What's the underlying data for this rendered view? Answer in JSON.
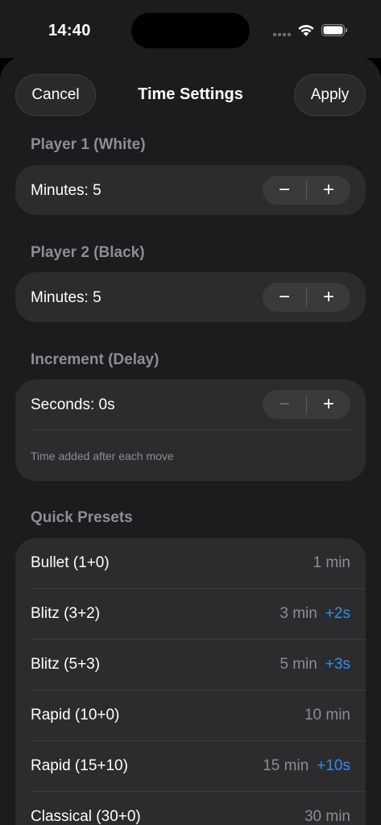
{
  "status": {
    "time": "14:40"
  },
  "nav": {
    "cancel": "Cancel",
    "title": "Time Settings",
    "apply": "Apply"
  },
  "player1": {
    "header": "Player 1 (White)",
    "label": "Minutes: 5",
    "minus": "−",
    "plus": "+"
  },
  "player2": {
    "header": "Player 2 (Black)",
    "label": "Minutes: 5",
    "minus": "−",
    "plus": "+"
  },
  "increment": {
    "header": "Increment (Delay)",
    "label": "Seconds: 0s",
    "minus": "−",
    "plus": "+",
    "minus_disabled": true,
    "note": "Time added after each move"
  },
  "presets": {
    "header": "Quick Presets",
    "items": [
      {
        "name": "Bullet (1+0)",
        "minutes": "1 min",
        "increment": ""
      },
      {
        "name": "Blitz (3+2)",
        "minutes": "3 min",
        "increment": "+2s"
      },
      {
        "name": "Blitz (5+3)",
        "minutes": "5 min",
        "increment": "+3s"
      },
      {
        "name": "Rapid (10+0)",
        "minutes": "10 min",
        "increment": ""
      },
      {
        "name": "Rapid (15+10)",
        "minutes": "15 min",
        "increment": "+10s"
      },
      {
        "name": "Classical (30+0)",
        "minutes": "30 min",
        "increment": ""
      }
    ]
  },
  "colors": {
    "accent": "#2e8ef0",
    "background": "#1c1c1e",
    "card": "#2c2c2e",
    "secondary_text": "#8d8d93"
  },
  "icons": [
    "signal-icon",
    "wifi-icon",
    "battery-icon"
  ]
}
